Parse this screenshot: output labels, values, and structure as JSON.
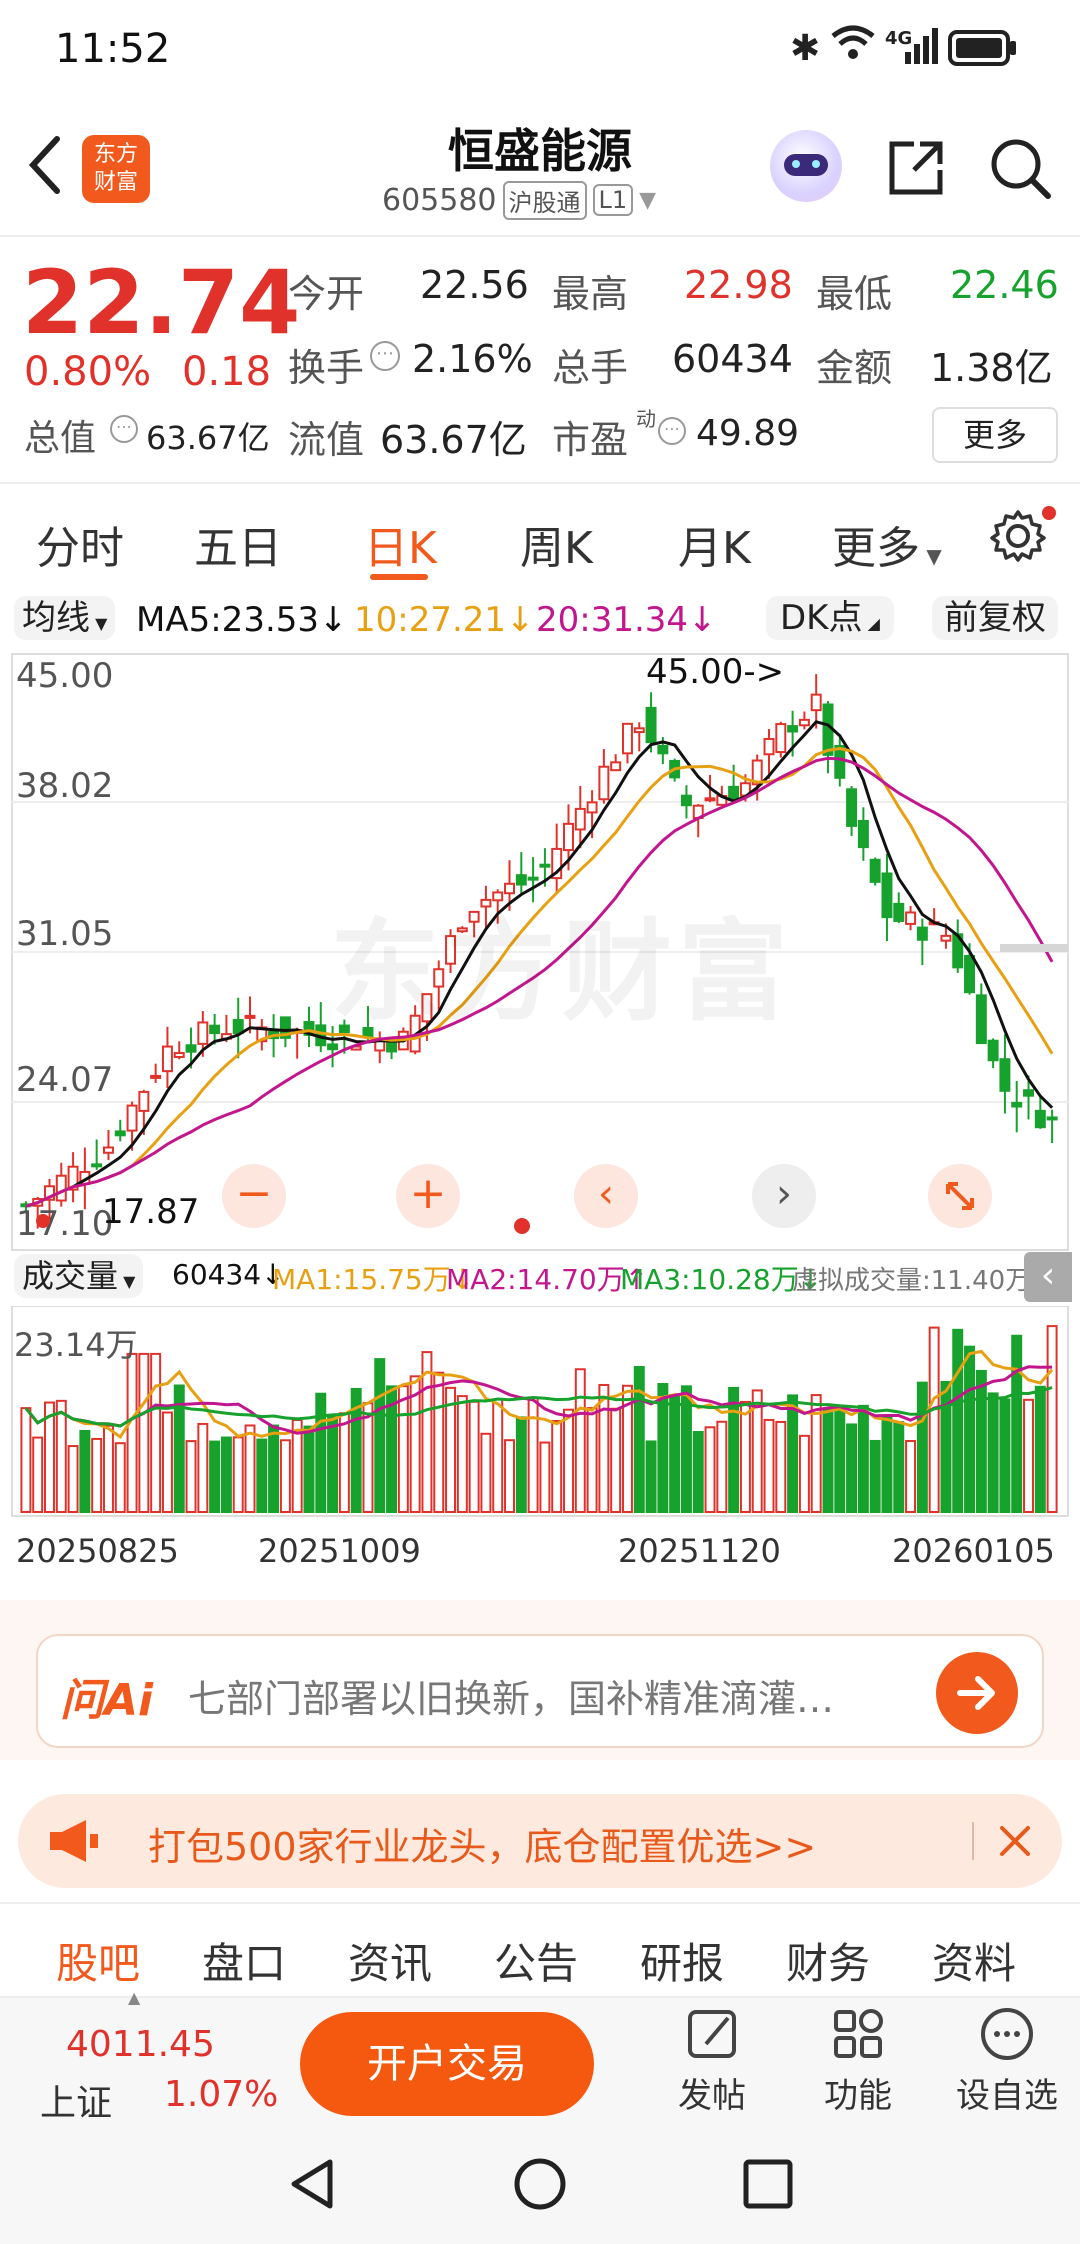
{
  "status_bar": {
    "time": "11:52",
    "network": "4G"
  },
  "header": {
    "logo_text_1": "东方",
    "logo_text_2": "财富",
    "stock_name": "恒盛能源",
    "stock_code": "605580",
    "tag_hgt": "沪股通",
    "tag_level": "L1"
  },
  "quote": {
    "price": "22.74",
    "change_pct": "0.80%",
    "change_abs": "0.18",
    "open_label": "今开",
    "open": "22.56",
    "high_label": "最高",
    "high": "22.98",
    "low_label": "最低",
    "low": "22.46",
    "turnover_label": "换手",
    "turnover": "2.16%",
    "volume_label": "总手",
    "volume": "60434",
    "amount_label": "金额",
    "amount": "1.38亿",
    "mktcap_label": "总值",
    "mktcap": "63.67亿",
    "float_label": "流值",
    "float_cap": "63.67亿",
    "pe_label": "市盈",
    "pe_sup": "动",
    "pe": "49.89",
    "more_label": "更多"
  },
  "period_tabs": [
    "分时",
    "五日",
    "日K",
    "周K",
    "月K",
    "更多"
  ],
  "active_tab": "日K",
  "ma_bar": {
    "selector": "均线",
    "ma5": "MA5:23.53↓",
    "ma10": "10:27.21↓",
    "ma20": "20:31.34↓",
    "dk": "DK点",
    "fq": "前复权"
  },
  "kline": {
    "y_labels": [
      "45.00",
      "38.02",
      "31.05",
      "24.07"
    ],
    "bottom_label": "17.10",
    "max_annot": "45.00->",
    "min_annot": "17.87",
    "watermark": "东方财富"
  },
  "volume_bar": {
    "selector": "成交量",
    "value": "60434↓",
    "ma1": "MA1:15.75万↓",
    "ma2": "MA2:14.70万↑",
    "ma3": "MA3:10.28万↓",
    "virtual": "虚拟成交量:11.40万",
    "max_label": "23.14万"
  },
  "dates": [
    "20250825",
    "20251009",
    "20251120",
    "20260105"
  ],
  "ai": {
    "logo": "问Ai",
    "prompt": "七部门部署以旧换新，国补精准滴灌…"
  },
  "banner": {
    "text": "打包500家行业龙头，底仓配置优选>>"
  },
  "bottom_tabs": [
    "股吧",
    "盘口",
    "资讯",
    "公告",
    "研报",
    "财务",
    "资料"
  ],
  "index": {
    "value": "4011.45",
    "name": "上证",
    "change": "1.07%"
  },
  "trade_button": "开户交易",
  "actions": [
    "发帖",
    "功能",
    "设自选"
  ],
  "colors": {
    "up": "#e0322b",
    "down": "#17a12d",
    "accent": "#ff6a13"
  }
}
